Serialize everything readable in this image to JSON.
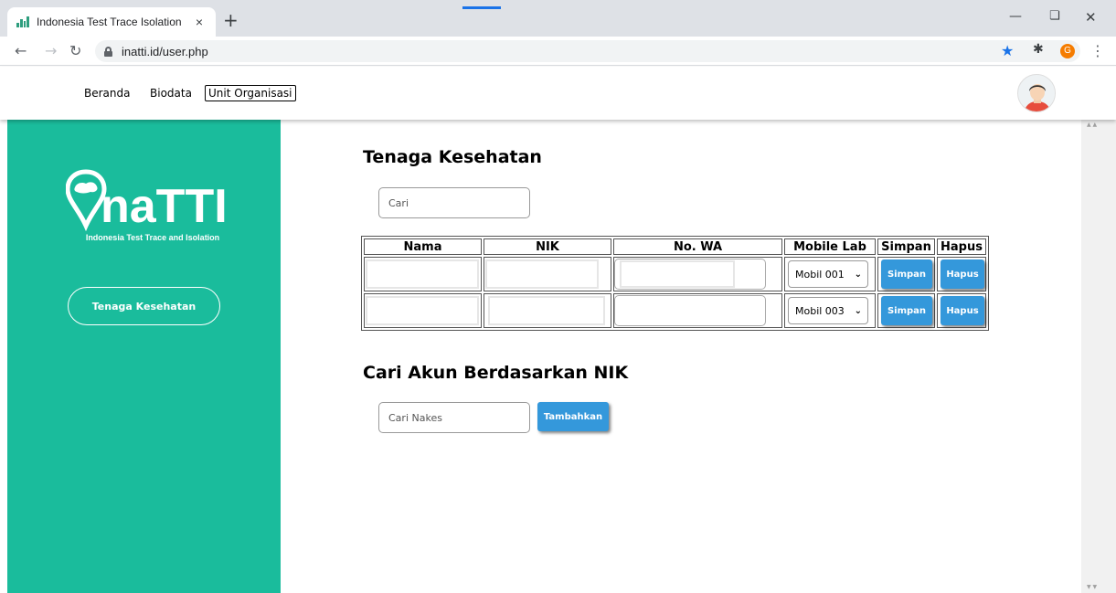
{
  "browser": {
    "tab_title": "Indonesia Test Trace Isolation",
    "tab_close": "×",
    "new_tab": "+",
    "url": "inatti.id/user.php",
    "profile_initial": "G"
  },
  "nav": {
    "links": [
      "Beranda",
      "Biodata",
      "Unit Organisasi"
    ]
  },
  "sidebar": {
    "logo_text": "naTTI",
    "logo_subtitle": "Indonesia Test Trace and Isolation",
    "button_label": "Tenaga Kesehatan",
    "color": "#1abc9c"
  },
  "main": {
    "title": "Tenaga Kesehatan",
    "search_placeholder": "Cari",
    "table": {
      "headers": [
        "Nama",
        "NIK",
        "No. WA",
        "Mobile Lab",
        "Simpan",
        "Hapus"
      ],
      "rows": [
        {
          "nama": "",
          "nik": "",
          "wa": "",
          "mobile_lab": "Mobil 001",
          "simpan": "Simpan",
          "hapus": "Hapus"
        },
        {
          "nama": "",
          "nik": "",
          "wa": "",
          "mobile_lab": "Mobil 003",
          "simpan": "Simpan",
          "hapus": "Hapus"
        }
      ]
    },
    "search_nik_title": "Cari Akun Berdasarkan NIK",
    "search_nakes_placeholder": "Cari Nakes",
    "add_button": "Tambahkan"
  },
  "colors": {
    "accent_blue": "#3498db",
    "chrome_blue": "#1a73e8"
  }
}
